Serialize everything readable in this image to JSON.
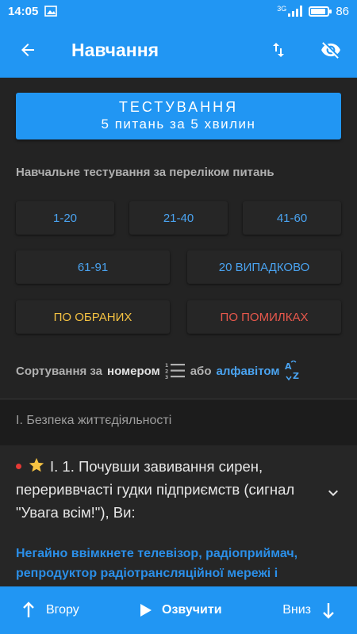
{
  "status": {
    "time": "14:05",
    "network": "3G",
    "battery": "86",
    "battery_level": 0.86
  },
  "appbar": {
    "title": "Навчання",
    "icons": [
      "arrow-back-icon",
      "swap-vert-icon",
      "visibility-off-icon"
    ]
  },
  "test_button": {
    "line1": "ТЕСТУВАННЯ",
    "line2": "5 питань за 5 хвилин"
  },
  "section_label": "Навчальне тестування за переліком питань",
  "ranges": {
    "r1": "1-20",
    "r2": "21-40",
    "r3": "41-60",
    "r4": "61-91",
    "random": "20 ВИПАДКОВО",
    "favorites": "ПО ОБРАНИХ",
    "mistakes": "ПО ПОМИЛКАХ"
  },
  "sort": {
    "prefix": "Сортування за",
    "by_number": "номером",
    "or": "або",
    "by_alpha": "алфавітом"
  },
  "chapter": "І. Безпека життєдіяльності",
  "question": {
    "text": "І. 1. Почувши завивання сирен, перериввчасті гудки підприємств (сигнал \"Увага всім!\"), Ви:",
    "answer": "Негайно ввімкнете телевізор, радіоприймач, репродуктор радіотрансляційної мережі і"
  },
  "bottom": {
    "up": "Вгору",
    "play": "Озвучити",
    "down": "Вниз"
  },
  "colors": {
    "primary": "#2196f3",
    "background": "#232323",
    "accent_link": "#4aa3f0",
    "favorite": "#f5c242",
    "error": "#e8584c"
  }
}
